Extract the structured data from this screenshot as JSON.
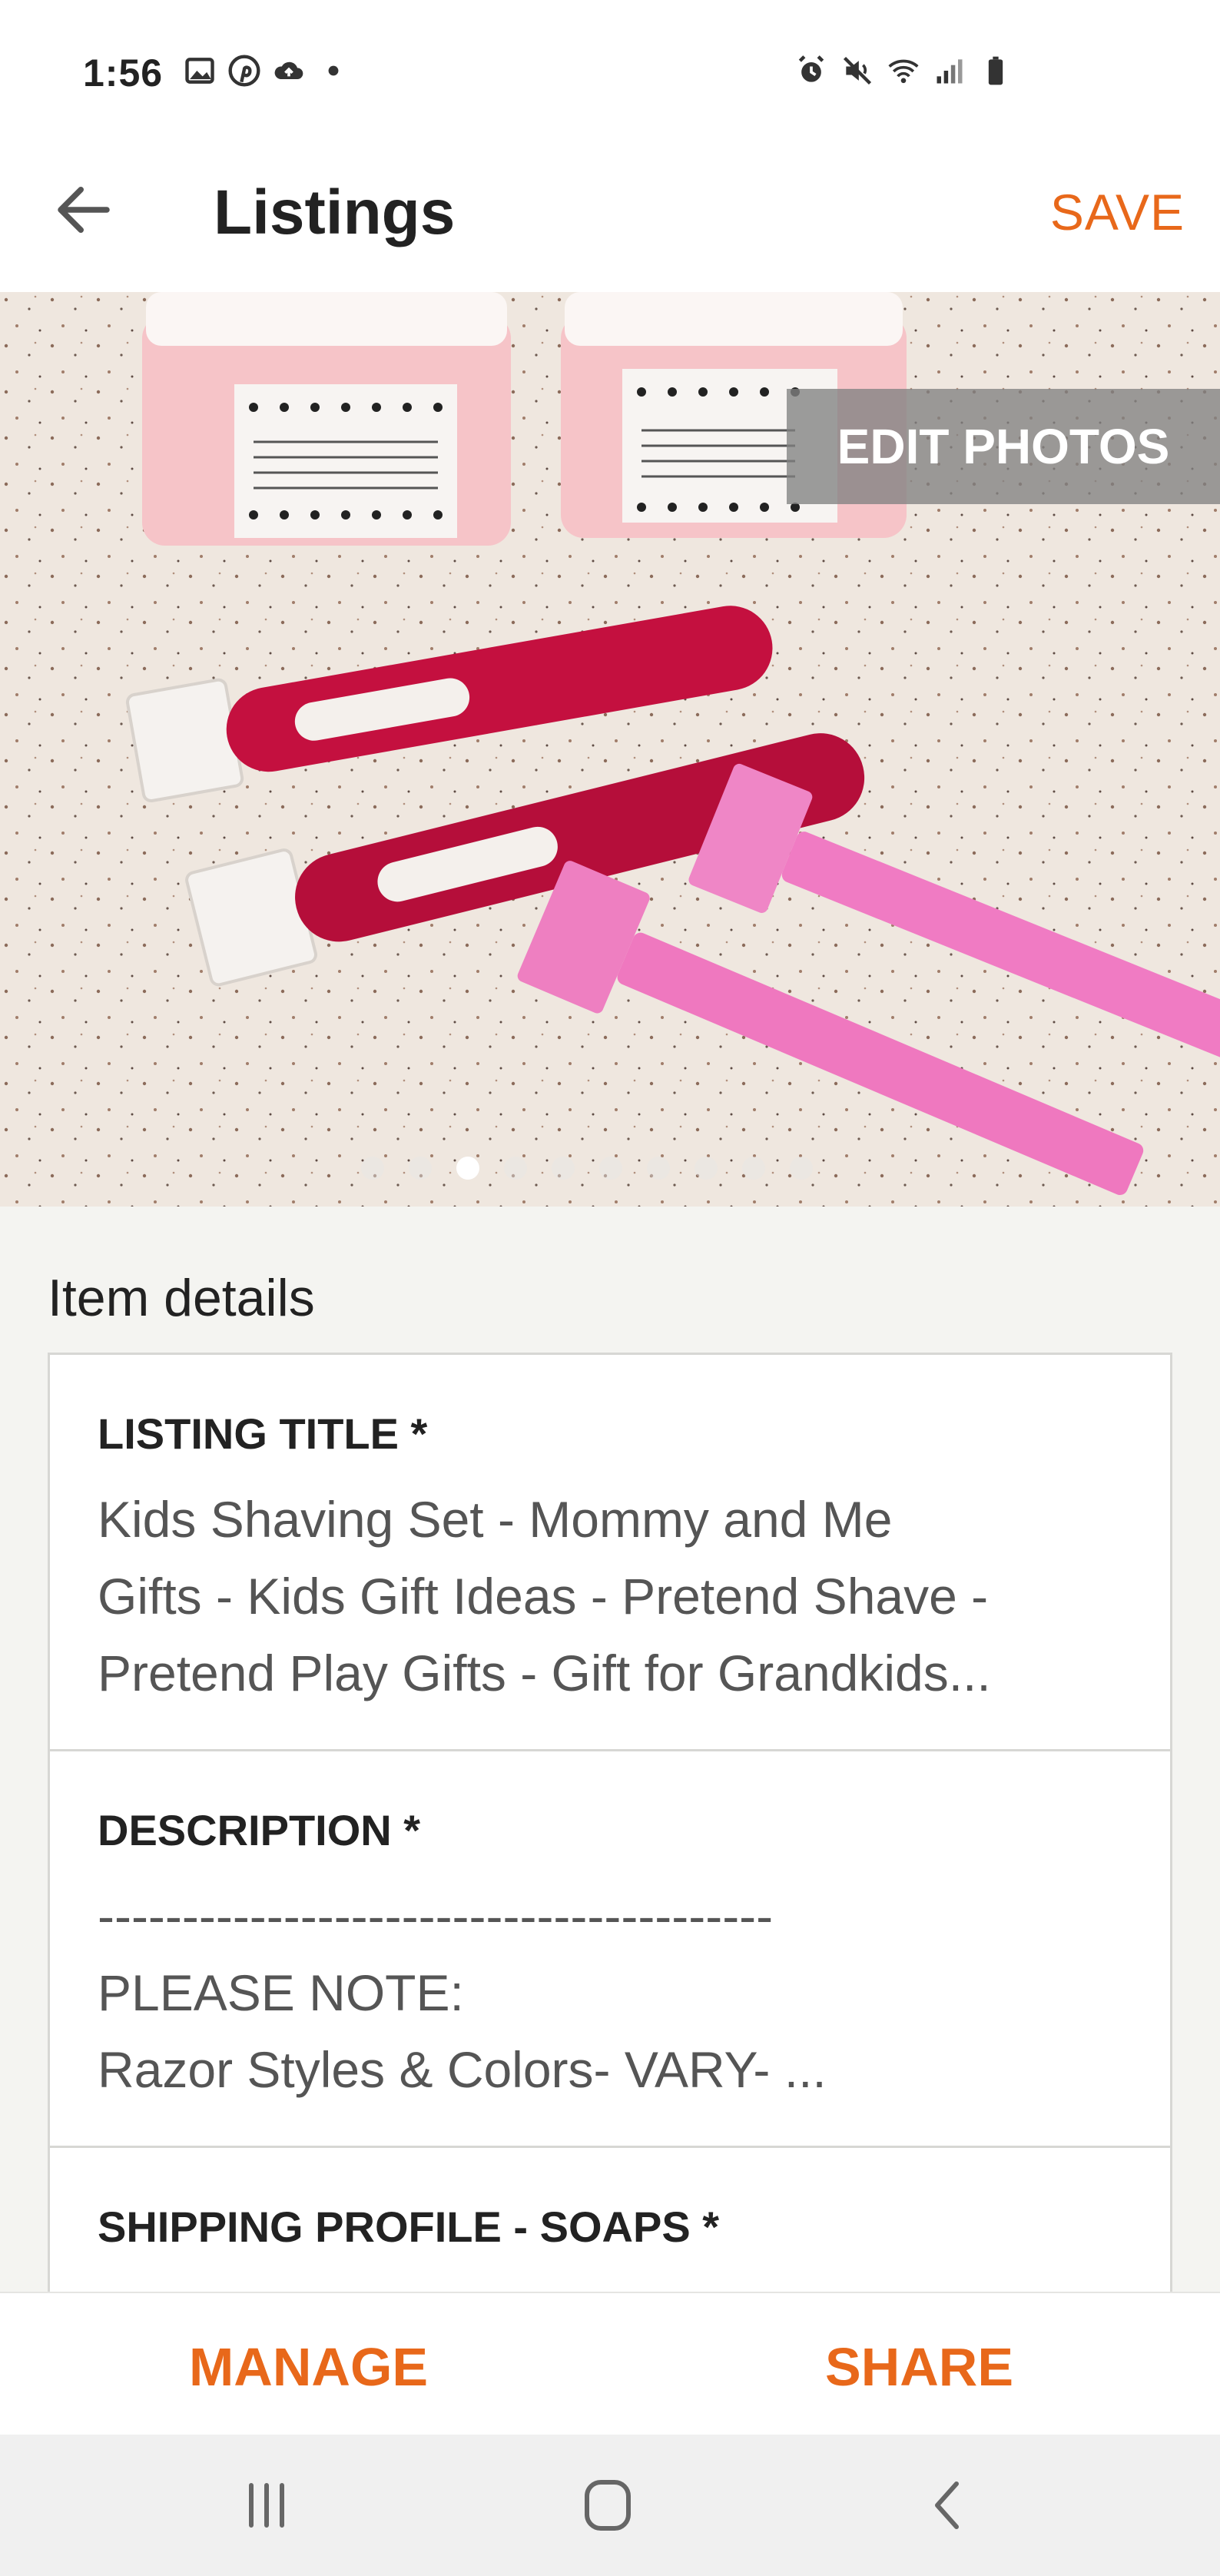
{
  "status_bar": {
    "time": "1:56",
    "left_icons": [
      "gallery-icon",
      "pinterest-icon",
      "cloud-upload-icon",
      "dot-icon"
    ],
    "right_icons": [
      "alarm-icon",
      "mute-icon",
      "wifi-icon",
      "signal-icon",
      "battery-icon"
    ]
  },
  "app_bar": {
    "title": "Listings",
    "save_label": "SAVE",
    "back_icon": "back-arrow-icon"
  },
  "photo": {
    "edit_label": "EDIT PHOTOS",
    "dot_count": 10,
    "active_dot": 2
  },
  "item_details": {
    "section_title": "Item details",
    "listing_title": {
      "label": "LISTING TITLE *",
      "lines": [
        "Kids Shaving Set - Mommy and Me",
        "Gifts - Kids Gift Ideas - Pretend Shave -",
        "Pretend Play Gifts - Gift for Grandkids..."
      ]
    },
    "description": {
      "label": "DESCRIPTION *",
      "lines": [
        "----------------------------------------",
        "PLEASE NOTE:",
        "Razor Styles & Colors- VARY- ..."
      ]
    },
    "shipping_profile": {
      "label": "SHIPPING PROFILE - SOAPS *"
    }
  },
  "actions": {
    "manage_label": "MANAGE",
    "share_label": "SHARE"
  },
  "colors": {
    "accent": "#e8681a",
    "background": "#f4f4f1",
    "card_border": "#d7d7d4"
  },
  "nav_bar": {
    "icons": [
      "recents-icon",
      "home-icon",
      "back-icon"
    ]
  }
}
